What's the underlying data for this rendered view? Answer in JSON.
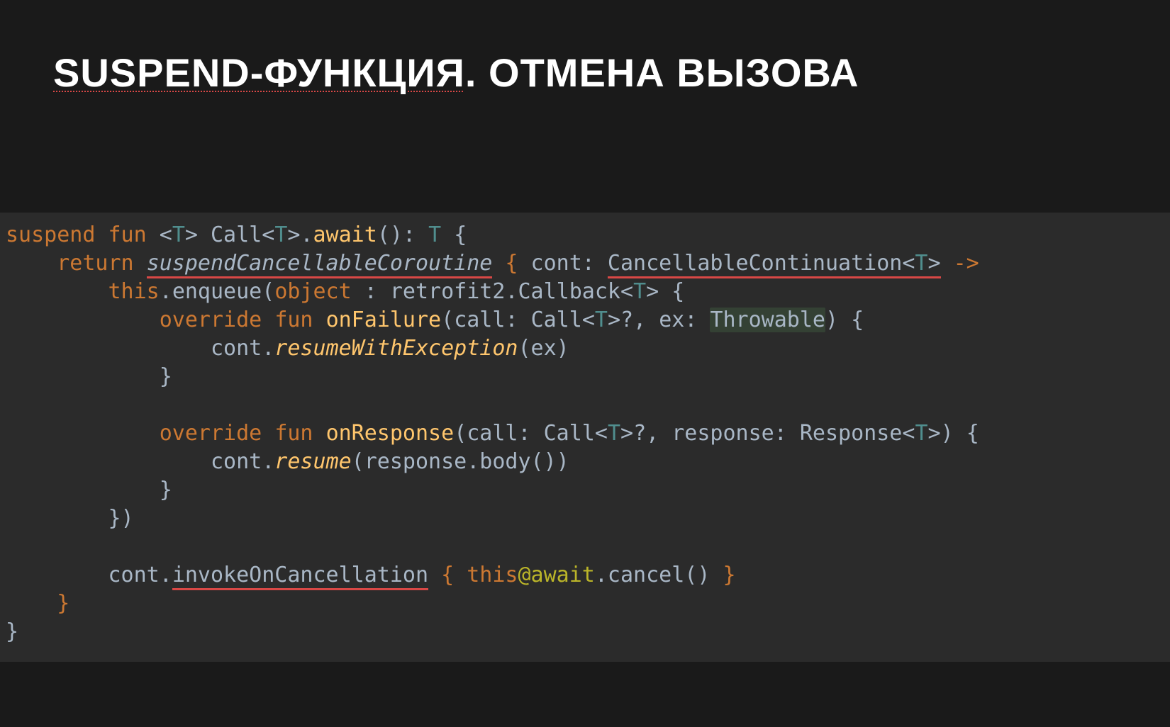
{
  "title": {
    "part1_spelled": "SUSPEND-ФУНКЦИЯ",
    "dot": ". ",
    "part2": "ОТМЕНА ВЫЗОВА"
  },
  "code": {
    "kw_suspend": "suspend",
    "kw_fun": "fun",
    "kw_return": "return",
    "kw_override": "override",
    "kw_object": "object",
    "kw_this": "this",
    "tparam_T": "T",
    "lt": "<",
    "gt": ">",
    "qmark": "?",
    "arrow": "->",
    "lbrace": "{",
    "rbrace": "}",
    "lparen": "(",
    "rparen": ")",
    "colon": ":",
    "comma": ",",
    "dot": ".",
    "id_Call": "Call",
    "fn_await": "await",
    "it_suspendCancellableCoroutine": "suspendCancellableCoroutine",
    "id_cont": "cont",
    "id_CancellableContinuation": "CancellableContinuation",
    "id_enqueue": "enqueue",
    "id_retrofit2": "retrofit2",
    "id_Callback": "Callback",
    "fn_onFailure": "onFailure",
    "id_call": "call",
    "id_ex": "ex",
    "id_Throwable": "Throwable",
    "fn_resumeWithException": "resumeWithException",
    "fn_onResponse": "onResponse",
    "id_response": "response",
    "id_Response": "Response",
    "fn_resume": "resume",
    "id_body": "body",
    "fn_invokeOnCancellation": "invokeOnCancellation",
    "at_await": "@await",
    "id_cancel": "cancel"
  }
}
